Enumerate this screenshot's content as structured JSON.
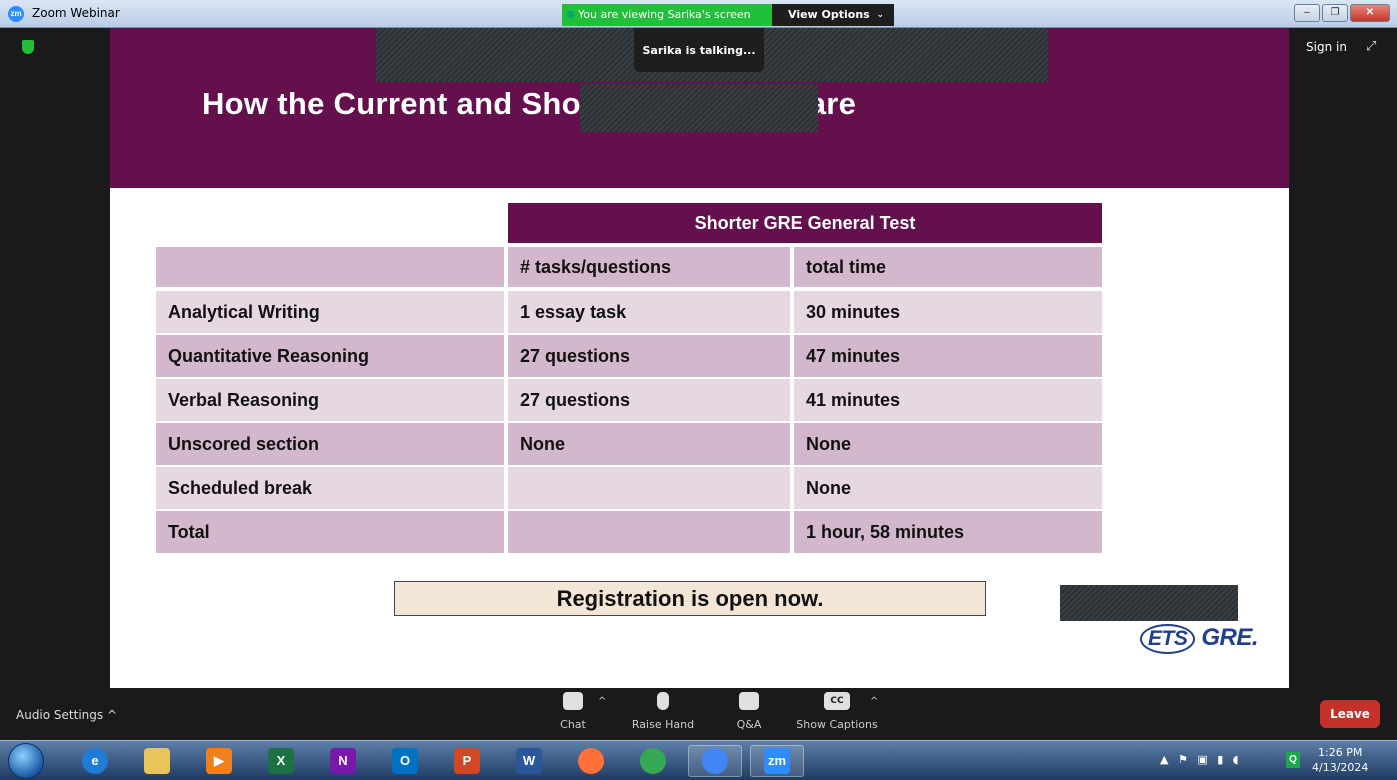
{
  "window": {
    "app_icon_text": "zm",
    "title": "Zoom Webinar",
    "minimize": "–",
    "maximize": "❐",
    "close": "✕"
  },
  "banner": {
    "viewing_text": "You are viewing Sarika's screen",
    "view_options": "View Options",
    "view_options_chevron": "⌄",
    "talking": "Sarika is talking..."
  },
  "meeting": {
    "sign_in": "Sign in",
    "expand_icon": "⤢"
  },
  "slide": {
    "title": "How the Current and Shorter GRE Compare",
    "table": {
      "group_header": "Shorter GRE General Test",
      "col_headers": [
        "",
        "# tasks/questions",
        "total time"
      ],
      "rows": [
        [
          "Analytical Writing",
          "1 essay task",
          "30 minutes"
        ],
        [
          "Quantitative Reasoning",
          "27 questions",
          "47 minutes"
        ],
        [
          "Verbal Reasoning",
          "27 questions",
          "41 minutes"
        ],
        [
          "Unscored section",
          "None",
          "None"
        ],
        [
          "Scheduled break",
          "",
          "None"
        ],
        [
          "Total",
          "",
          "1 hour, 58 minutes"
        ]
      ]
    },
    "registration": "Registration is open now.",
    "logo_ets": "ETS",
    "logo_gre": "GRE."
  },
  "toolbar": {
    "audio_settings": "Audio Settings",
    "audio_caret": "^",
    "chat": "Chat",
    "raise_hand": "Raise Hand",
    "qa": "Q&A",
    "captions": "Show Captions",
    "cc": "CC",
    "caret": "^",
    "leave": "Leave"
  },
  "taskbar": {
    "apps": [
      {
        "name": "internet-explorer",
        "glyph": "e",
        "color": "#1e7bd6"
      },
      {
        "name": "file-explorer",
        "glyph": "",
        "color": "#e8c45a"
      },
      {
        "name": "media-player",
        "glyph": "▶",
        "color": "#f0801e"
      },
      {
        "name": "excel",
        "glyph": "X",
        "color": "#1e7145"
      },
      {
        "name": "onenote",
        "glyph": "N",
        "color": "#7719aa"
      },
      {
        "name": "outlook",
        "glyph": "O",
        "color": "#0072c6"
      },
      {
        "name": "powerpoint",
        "glyph": "P",
        "color": "#d24726"
      },
      {
        "name": "word",
        "glyph": "W",
        "color": "#2b579a"
      },
      {
        "name": "firefox",
        "glyph": "",
        "color": "#ff7139"
      },
      {
        "name": "chrome",
        "glyph": "",
        "color": "#34a853"
      },
      {
        "name": "chrome-profile",
        "glyph": "",
        "color": "#4285f4"
      },
      {
        "name": "zoom",
        "glyph": "zm",
        "color": "#2d8cff"
      }
    ],
    "tray_icons": "▲ ⚑ ▣ ▮ ◖",
    "tray_q": "Q",
    "time": "1:26 PM",
    "date": "4/13/2024"
  }
}
